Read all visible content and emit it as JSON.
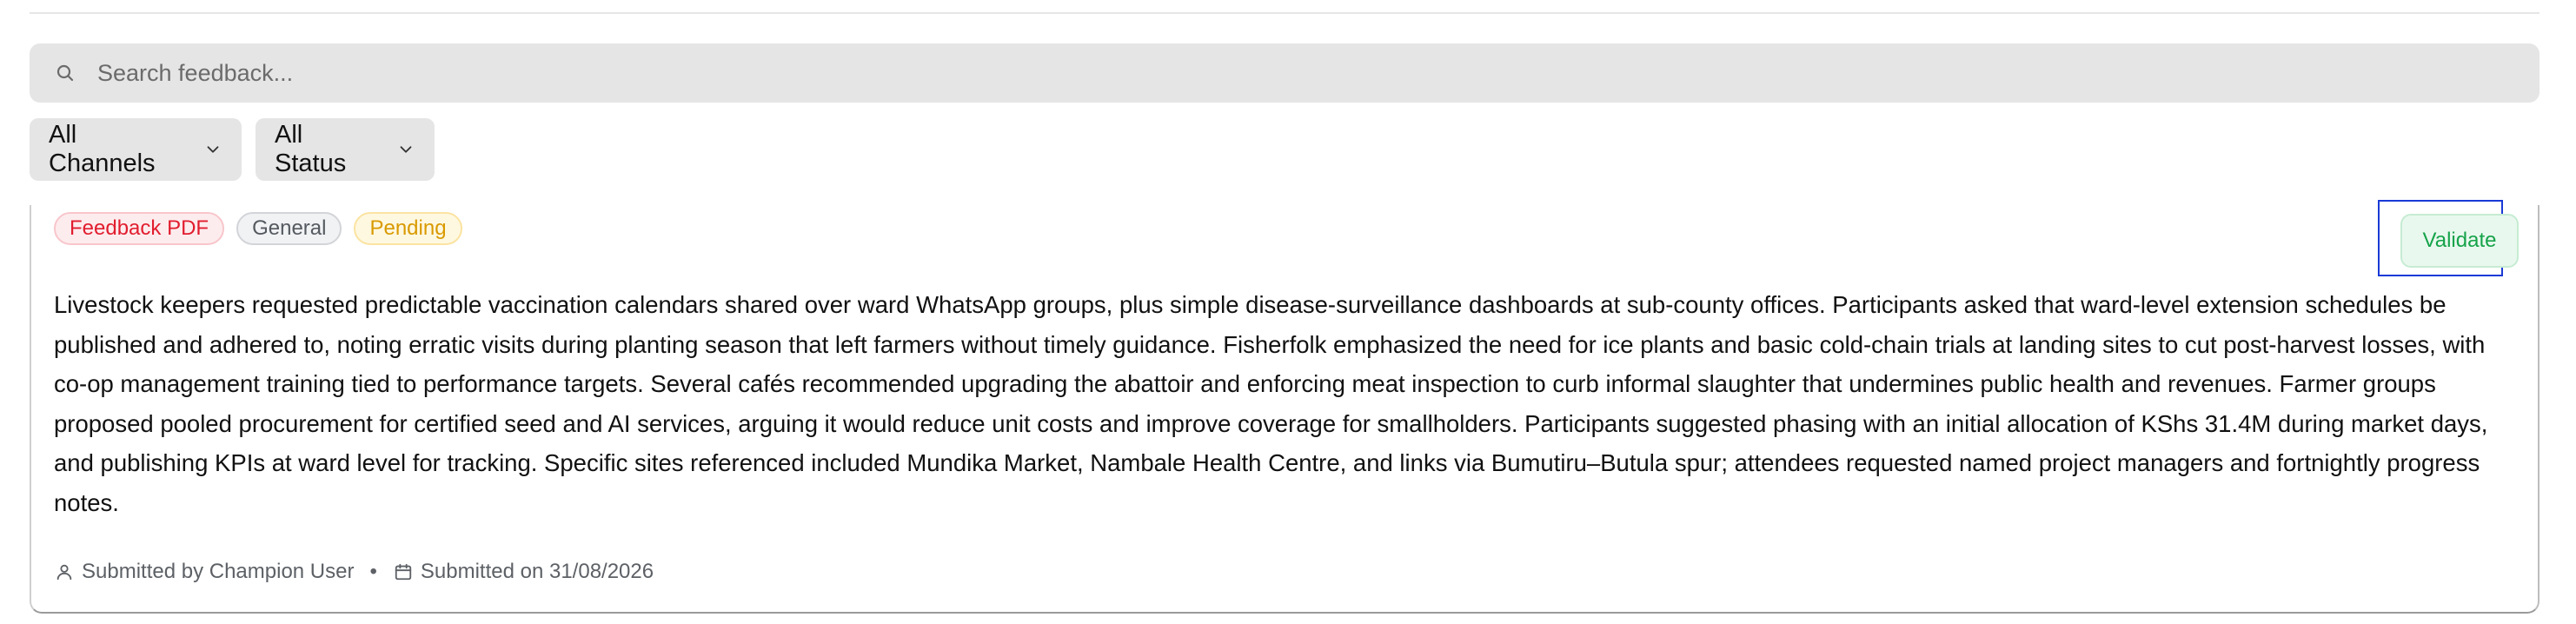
{
  "search": {
    "placeholder": "Search feedback..."
  },
  "filters": {
    "channels_label": "All Channels",
    "status_label": "All Status"
  },
  "card": {
    "badges": {
      "source": "Feedback PDF",
      "category": "General",
      "status": "Pending"
    },
    "validate_label": "Validate",
    "body": "Livestock keepers requested predictable vaccination calendars shared over ward WhatsApp groups, plus simple disease-surveillance dashboards at sub-county offices. Participants asked that ward-level extension schedules be published and adhered to, noting erratic visits during planting season that left farmers without timely guidance. Fisherfolk emphasized the need for ice plants and basic cold-chain trials at landing sites to cut post-harvest losses, with co-op management training tied to performance targets. Several cafés recommended upgrading the abattoir and enforcing meat inspection to curb informal slaughter that undermines public health and revenues. Farmer groups proposed pooled procurement for certified seed and AI services, arguing it would reduce unit costs and improve coverage for smallholders. Participants suggested phasing with an initial allocation of KShs 31.4M during market days, and publishing KPIs at ward level for tracking. Specific sites referenced included Mundika Market, Nambale Health Centre, and links via Bumutiru–Butula spur; attendees requested named project managers and fortnightly progress notes.",
    "submitted_by": "Submitted by Champion User",
    "separator": "•",
    "submitted_on": "Submitted on 31/08/2026"
  },
  "colors": {
    "badge_pdf": "#e11d2e",
    "badge_pending": "#d99a00",
    "validate_text": "#16a34a",
    "highlight_box": "#1a3ad6"
  },
  "icons": [
    "search-icon",
    "chevron-down-icon",
    "user-icon",
    "calendar-icon"
  ]
}
